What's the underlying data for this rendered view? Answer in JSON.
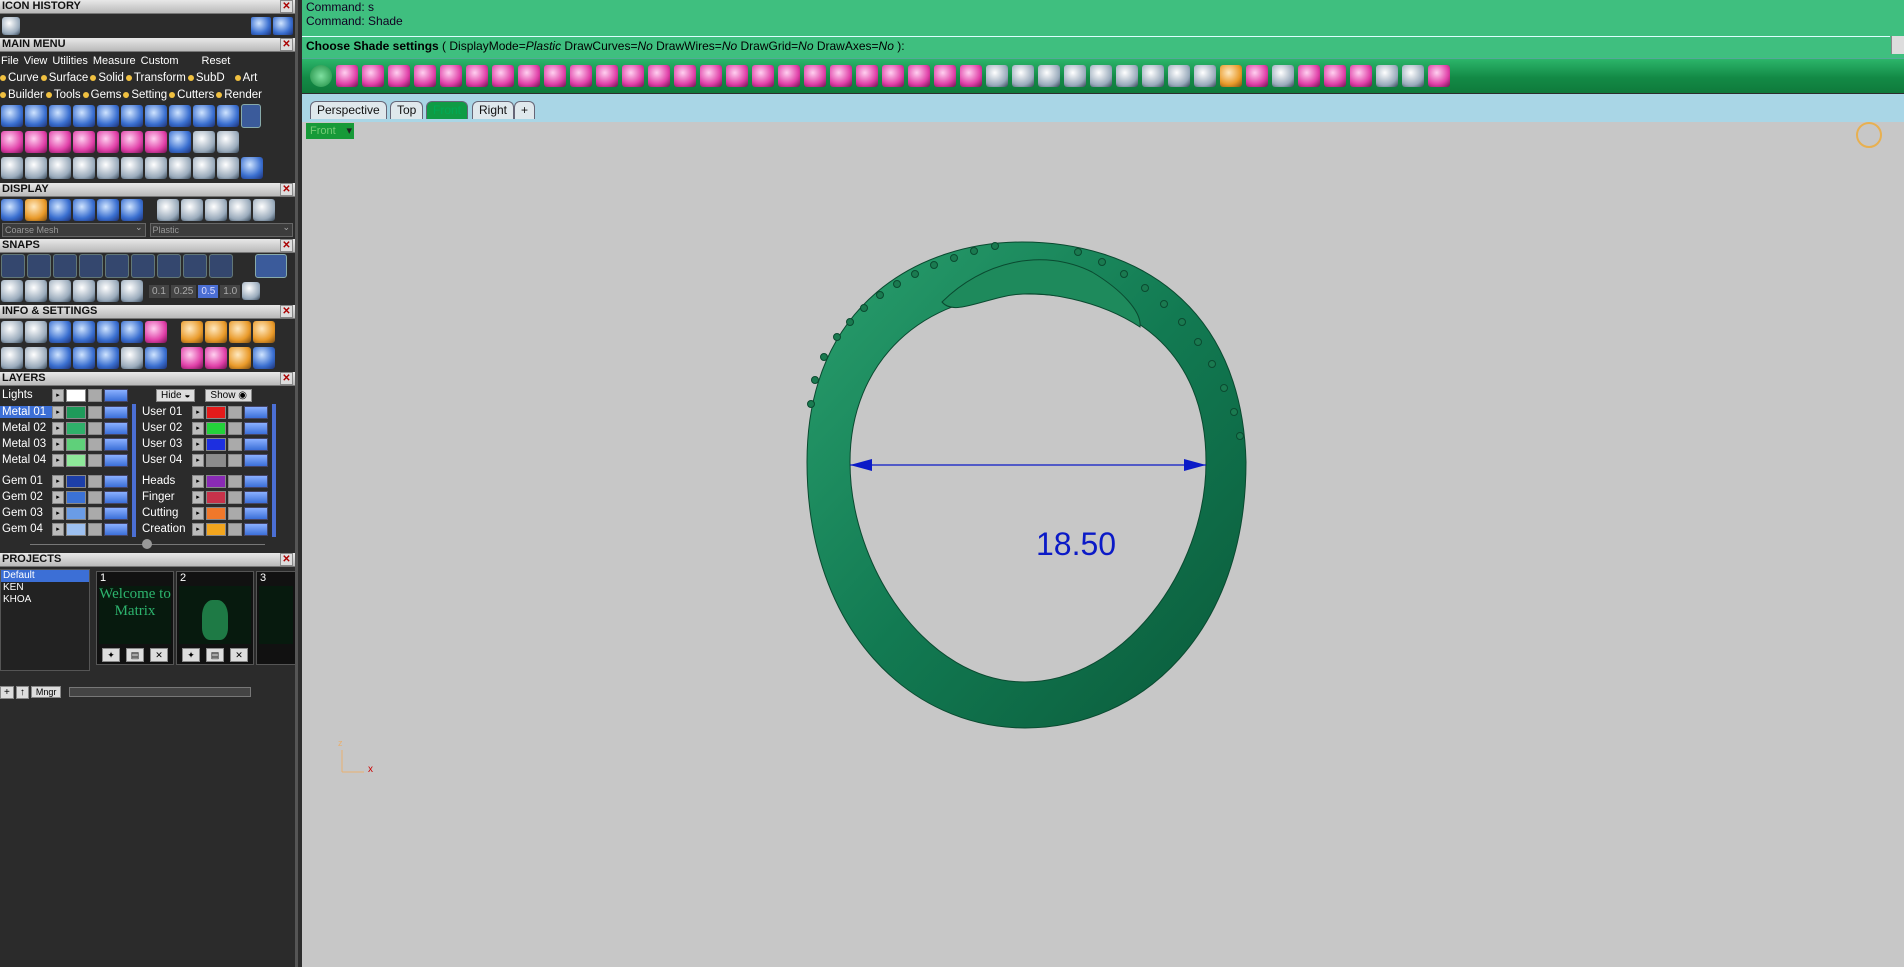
{
  "left": {
    "icon_history_title": "ICON HISTORY",
    "main_menu_title": "MAIN MENU",
    "menu": [
      "File",
      "View",
      "Utilities",
      "Measure",
      "Custom",
      "Reset"
    ],
    "tabs1": [
      "Curve",
      "Surface",
      "Solid",
      "Transform",
      "SubD",
      "Art"
    ],
    "tabs2": [
      "Builder",
      "Tools",
      "Gems",
      "Setting",
      "Cutters",
      "Render"
    ],
    "display_title": "DISPLAY",
    "mesh_select": "Coarse Mesh",
    "material_select": "Plastic",
    "snaps_title": "SNAPS",
    "snap_values": [
      "0.1",
      "0.25",
      "0.5",
      "1.0"
    ],
    "info_title": "INFO & SETTINGS",
    "layers_title": "LAYERS",
    "lights_label": "Lights",
    "hide_label": "Hide",
    "show_label": "Show",
    "layers_left": [
      {
        "name": "Metal 01",
        "color": "#1f9a5a"
      },
      {
        "name": "Metal 02",
        "color": "#2fb06a"
      },
      {
        "name": "Metal 03",
        "color": "#5fd07a"
      },
      {
        "name": "Metal 04",
        "color": "#8ee89a"
      },
      {
        "name": "Gem 01",
        "color": "#1d3fa8"
      },
      {
        "name": "Gem 02",
        "color": "#3b72d6"
      },
      {
        "name": "Gem 03",
        "color": "#6a9ce6"
      },
      {
        "name": "Gem 04",
        "color": "#9dc0f0"
      }
    ],
    "layers_right": [
      {
        "name": "User 01",
        "color": "#e41b1b"
      },
      {
        "name": "User 02",
        "color": "#23d23a"
      },
      {
        "name": "User 03",
        "color": "#1d2fe0"
      },
      {
        "name": "User 04",
        "color": "#8c8c8c"
      },
      {
        "name": "Heads",
        "color": "#8a2bb5"
      },
      {
        "name": "Finger",
        "color": "#c8324a"
      },
      {
        "name": "Cutting",
        "color": "#f0782a"
      },
      {
        "name": "Creation",
        "color": "#f2a51e"
      }
    ],
    "projects_title": "PROJECTS",
    "projects": [
      "Default",
      "KEN",
      "KHOA"
    ],
    "thumbs": [
      {
        "num": "1",
        "caption": "Welcome to Matrix"
      },
      {
        "num": "2",
        "caption": ""
      },
      {
        "num": "3",
        "caption": ""
      }
    ],
    "mngr_label": "Mngr"
  },
  "command": {
    "line1": "Command: s",
    "line2": "Command: Shade",
    "prompt_bold": "Choose Shade settings",
    "prompt_rest": " ( DisplayMode=",
    "display_mode": "Plastic",
    "draw_curves_label": "  DrawCurves=",
    "draw_curves": "No",
    "draw_wires_label": "  DrawWires=",
    "draw_wires": "No",
    "draw_grid_label": "  DrawGrid=",
    "draw_grid": "No",
    "draw_axes_label": "  DrawAxes=",
    "draw_axes": "No",
    "prompt_end": " ):"
  },
  "viewport_tabs": [
    "Perspective",
    "Top",
    "Front",
    "Right",
    "+"
  ],
  "active_tab": "Front",
  "viewport_label": "Front",
  "measurement": "18.50",
  "axis_labels": {
    "z": "z",
    "x": "x"
  },
  "colors": {
    "ring": "#12805a",
    "accent_green": "#3fbf7f",
    "dimension": "#0b1ac7"
  }
}
